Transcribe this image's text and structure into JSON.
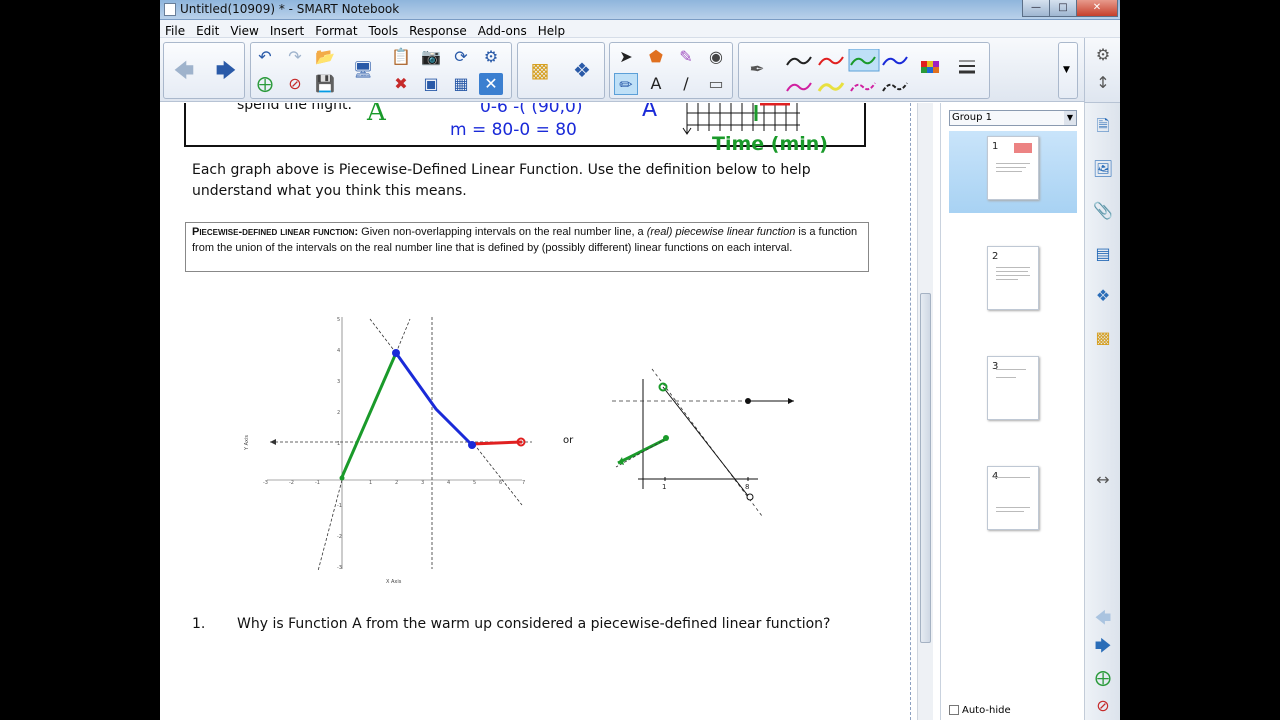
{
  "window": {
    "title": "Untitled(10909) * - SMART Notebook"
  },
  "menu": [
    "File",
    "Edit",
    "View",
    "Insert",
    "Format",
    "Tools",
    "Response",
    "Add-ons",
    "Help"
  ],
  "document": {
    "top_text": "spend the night.",
    "ink": {
      "letter_a1": "A",
      "eq1": "0-6  -( (90,0)",
      "eq2": "m = 80-0 = 80",
      "letter_a2": "A",
      "time_label": "Time (min)"
    },
    "intro_line1": "Each graph above is Piecewise-Defined Linear Function.  Use the definition below to help",
    "intro_line2": "understand what you think this means.",
    "definition": {
      "term": "Piecewise-defined linear function:",
      "text1": " Given non-overlapping intervals on the real number line, a ",
      "italic": "(real) piecewise linear function",
      "text2": " is a function from the union of the intervals on the real number line that is defined by (possibly different) linear functions on each interval."
    },
    "graph1": {
      "x_axis_label": "X Axis",
      "y_axis_label": "Y Axis",
      "x_ticks": [
        "-3",
        "-2",
        "-1",
        "1",
        "2",
        "3",
        "4",
        "5",
        "6",
        "7"
      ],
      "y_ticks": [
        "5",
        "4",
        "3",
        "2",
        "1",
        "-1",
        "-2",
        "-3"
      ]
    },
    "or_label": "or",
    "graph2": {
      "x_tick": "1",
      "x_tick_8": "8"
    },
    "question_number": "1.",
    "question_text": "Why is Function A from the warm up considered a piecewise-defined linear function?"
  },
  "sidepanel": {
    "group_label": "Group 1",
    "pages": [
      "1",
      "2",
      "3",
      "4"
    ],
    "autohide_label": "Auto-hide"
  },
  "colors": {
    "ink_green": "#1a9a2a",
    "ink_blue": "#1a2ad8",
    "ink_red": "#e02020"
  }
}
